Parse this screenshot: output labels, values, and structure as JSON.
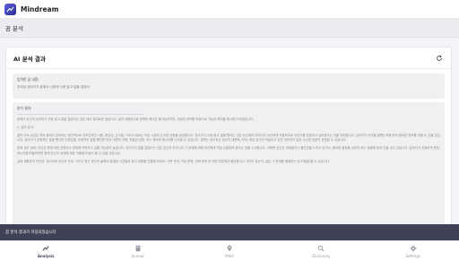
{
  "app": {
    "title": "Mindream"
  },
  "page": {
    "title": "꿈 분석"
  },
  "card": {
    "title": "AI 분석 결과",
    "input_label": "입력한 꿈 내용:",
    "input_text": "우리집 강아지가 꿈에서 나한테 사랑 말고 말을 걸었어.",
    "result_label": "분석 결과:",
    "paragraphs": [
      "꿈에서 당신의 강아지가 사랑 말고 말을 걸었다는 것은 매우 흥미로운 꿈입니다. 꿈의 내용만으로 완벽한 해석은 불가능하지만, 제공된 정보를 바탕으로 가능한 해석을 제시해 드리겠습니다.",
      "1. 심리 분석:",
      "꿈의 주요 상징은 여러 꿈에서 강아지는 일반적으로 무조건적인 사랑, 충성심, 순수함, 그리고 때로는 어린 시절의 순수한 감정을 상징합니다. 강아지가 사랑 말고 말을 했다는 것은 당신에게 무의식이 당신에게 직접적으로 무언가를 전달하고 싶어한다는 것을 의미합니다. 강아지가 무엇을 말했는지에 따라 중요한 정보를 얻을 수 있을 것입니다. 강아지가 긍정적인 말을 했다면 안정감을, 부정적인 말을 했다면 당신 내면의 걱정, 억압된 감정, 또는 중요한 메시지를 나타낼 수 있습니다. 말하는 강아지는 당신의 내면에, 자아, 혹은 당신의 억눌리고 있던 어린아이 같은 순수한 감정의 표현일 수 있습니다.",
      "현재 심리 상태: 당신은 현재 어떤 감정이나 문제에 직면하고 있을 가능성이 높습니다. 강아지가 말을 걸었다는 것은 당신의 무의식이 그 문제에 대해 당신에게 직접 소통하려 한다는 것을 시사합니다. 어쩌면 당신은 외로움이나 불안감을 느끼고 있거나, 중요한 결정을 내려야 하는 상황에 놓여 있을 수도 있습니다. 강아지가 친밀하게 했던 메시지를 떠올려보면 현재 당신의 상태에 대한 이해에 도움이 될 수 있을 것입니다.",
      "실제 생활과의 연관성: 강아지와 당신의 관계, 그리고 최근 당신의 삶에서 발생한 사건들과 꿈의 내용을 연결해 보세요. 가족 관계, 직장 문제, 연애 문제 등 어떤 부분에서 불안함이나 고민이 있는지, 꿈은 그 문제를 해결하는 데 도움을 줄 수 있습니다."
    ]
  },
  "toast": {
    "text": "꿈 분석 결과가 저장되었습니다"
  },
  "nav": {
    "items": [
      {
        "label": "Analysis",
        "icon": "analysis-icon",
        "active": true
      },
      {
        "label": "Journal",
        "icon": "journal-icon",
        "active": false
      },
      {
        "label": "Mind",
        "icon": "mind-icon",
        "active": false
      },
      {
        "label": "Dictionary",
        "icon": "dictionary-icon",
        "active": false
      },
      {
        "label": "Settings",
        "icon": "settings-icon",
        "active": false
      }
    ]
  },
  "colors": {
    "brand": "#4f51d0",
    "toast_bg": "#3f4156"
  }
}
